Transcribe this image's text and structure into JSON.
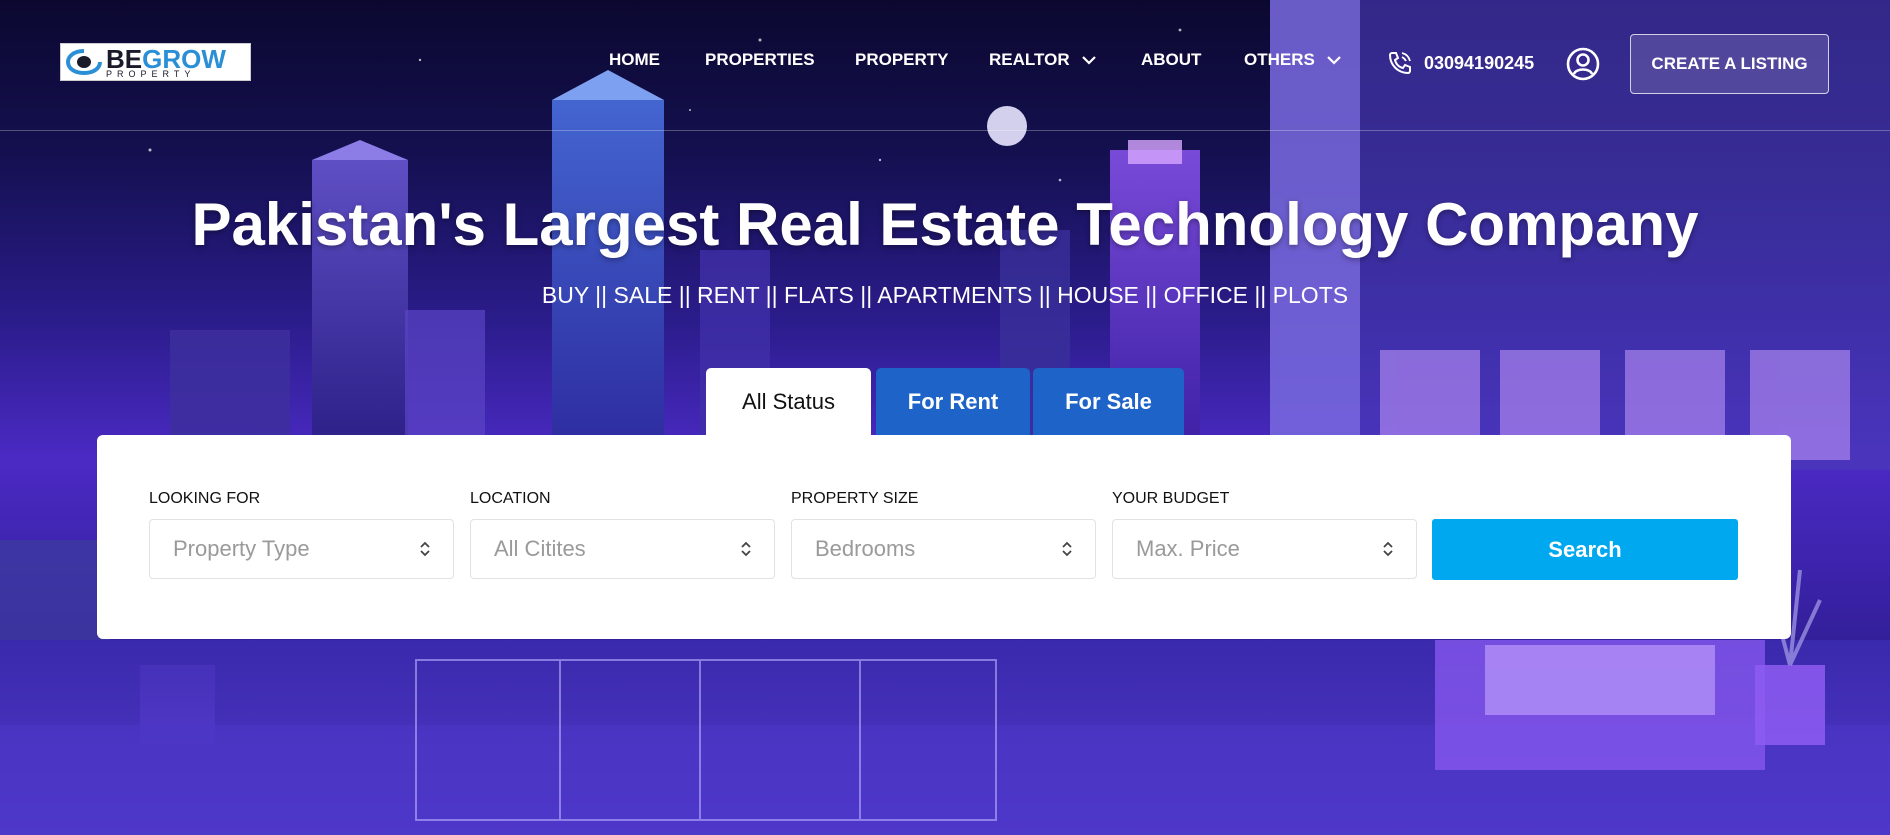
{
  "brand": {
    "name_part1": "BE",
    "name_part2": "GROW",
    "tagline": "PROPERTY"
  },
  "nav": {
    "items": [
      {
        "label": "HOME"
      },
      {
        "label": "PROPERTIES"
      },
      {
        "label": "PROPERTY"
      },
      {
        "label": "REALTOR"
      },
      {
        "label": "ABOUT"
      },
      {
        "label": "OTHERS"
      }
    ],
    "phone": "03094190245",
    "cta_label": "CREATE A LISTING"
  },
  "hero": {
    "title": "Pakistan's Largest Real Estate Technology Company",
    "subtitle": "BUY || SALE || RENT || FLATS || APARTMENTS || HOUSE || OFFICE || PLOTS"
  },
  "tabs": [
    {
      "label": "All Status"
    },
    {
      "label": "For Rent"
    },
    {
      "label": "For Sale"
    }
  ],
  "search": {
    "fields": [
      {
        "label": "LOOKING FOR",
        "value": "Property Type"
      },
      {
        "label": "LOCATION",
        "value": "All Citites"
      },
      {
        "label": "PROPERTY SIZE",
        "value": "Bedrooms"
      },
      {
        "label": "YOUR BUDGET",
        "value": "Max. Price"
      }
    ],
    "button_label": "Search"
  },
  "colors": {
    "accent": "#00a8f0",
    "tab_blue": "#1d63c8",
    "sky_dark": "#0b0830",
    "violet": "#4b2ac4"
  }
}
